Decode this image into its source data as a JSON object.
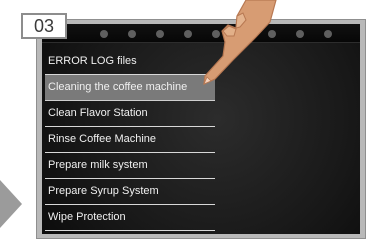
{
  "step_badge": {
    "label": "03"
  },
  "menu": {
    "items": [
      {
        "label": "ERROR LOG files",
        "active": false
      },
      {
        "label": "Cleaning the coffee machine",
        "active": true
      },
      {
        "label": "Clean Flavor Station",
        "active": false
      },
      {
        "label": "Rinse Coffee Machine",
        "active": false
      },
      {
        "label": "Prepare milk system",
        "active": false
      },
      {
        "label": "Prepare Syrup System",
        "active": false
      },
      {
        "label": "Wipe Protection",
        "active": false
      }
    ]
  },
  "icons": {
    "hand": "pointing-hand-icon",
    "arrow": "right-arrow-icon"
  },
  "colors": {
    "screen_background": "#1b1b1b",
    "menu_text": "#f0f0f0",
    "menu_highlight": "#7a7a7a",
    "frame": "#b9b9b9"
  }
}
